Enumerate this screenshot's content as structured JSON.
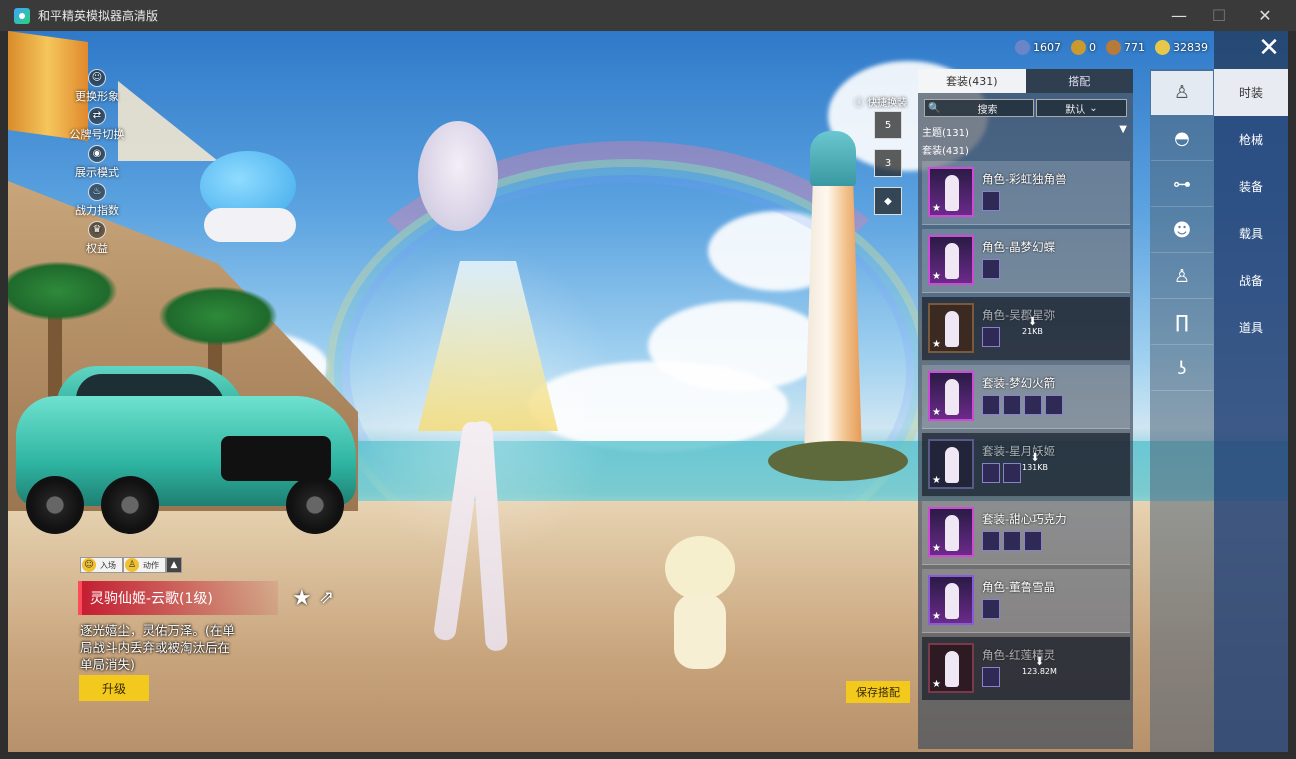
{
  "window": {
    "title": "和平精英模拟器高清版",
    "min": "—",
    "max": "☐",
    "close": "✕"
  },
  "left_menu": [
    {
      "label": "更换形象",
      "icon": "person-icon"
    },
    {
      "label": "公牌号切换",
      "icon": "switch-icon"
    },
    {
      "label": "展示模式",
      "icon": "eye-icon"
    },
    {
      "label": "战力指数",
      "icon": "flame-icon"
    },
    {
      "label": "权益",
      "icon": "crown-icon"
    }
  ],
  "action_bar": {
    "enter_label": "入场",
    "motion_label": "动作",
    "up": "▲"
  },
  "item": {
    "name": "灵驹仙姬-云歌(1级)",
    "description": "逐光嬉尘，灵佑万泽。(在单局战斗内丢弃或被淘汰后在单局消失)",
    "upgrade_label": "升级"
  },
  "save_label": "保存搭配",
  "currency": [
    {
      "value": "1607",
      "icon": "coin-blue-icon",
      "color": "#6a86c8"
    },
    {
      "value": "0",
      "icon": "coin-gold-icon",
      "color": "#c99a2e"
    },
    {
      "value": "771",
      "icon": "coin-bronze-icon",
      "color": "#b77a3b"
    },
    {
      "value": "32839",
      "icon": "coin-uc-icon",
      "color": "#e8c84a"
    }
  ],
  "close_label": "✕",
  "quick": {
    "label": "快捷换装",
    "buttons": [
      "5",
      "3",
      "◆"
    ]
  },
  "panel": {
    "tabs": [
      "套装(431)",
      "搭配"
    ],
    "search_label": "搜索",
    "search_icon": "🔍",
    "sort_label": "默认",
    "theme_label": "主题(131)",
    "theme_arrow": "▼",
    "suit_label": "套装(431)",
    "cards": [
      {
        "name": "角色-彩虹独角兽",
        "subs": 1,
        "dim": false
      },
      {
        "name": "角色-晶梦幻蝶",
        "subs": 1,
        "dim": false
      },
      {
        "name": "角色-吴郡星弥",
        "subs": 1,
        "dim": true,
        "size": "21KB"
      },
      {
        "name": "套装-梦幻火箭",
        "subs": 4,
        "dim": false
      },
      {
        "name": "套装-星月妖姬",
        "subs": 2,
        "dim": true,
        "size": "131KB"
      },
      {
        "name": "套装-甜心巧克力",
        "subs": 3,
        "dim": false
      },
      {
        "name": "角色-董鲁雪晶",
        "subs": 1,
        "dim": false
      },
      {
        "name": "角色-红莲精灵",
        "subs": 1,
        "dim": true,
        "size": "123.82M"
      }
    ]
  },
  "categories": [
    {
      "label": "时装",
      "icon": "outfit-icon"
    },
    {
      "label": "枪械",
      "icon": "cap-icon"
    },
    {
      "label": "装备",
      "icon": "glasses-icon"
    },
    {
      "label": "载具",
      "icon": "mask-icon"
    },
    {
      "label": "战备",
      "icon": "body-icon"
    },
    {
      "label": "道具",
      "icon": "pants-icon"
    },
    {
      "label": "",
      "icon": "shoes-icon"
    }
  ]
}
